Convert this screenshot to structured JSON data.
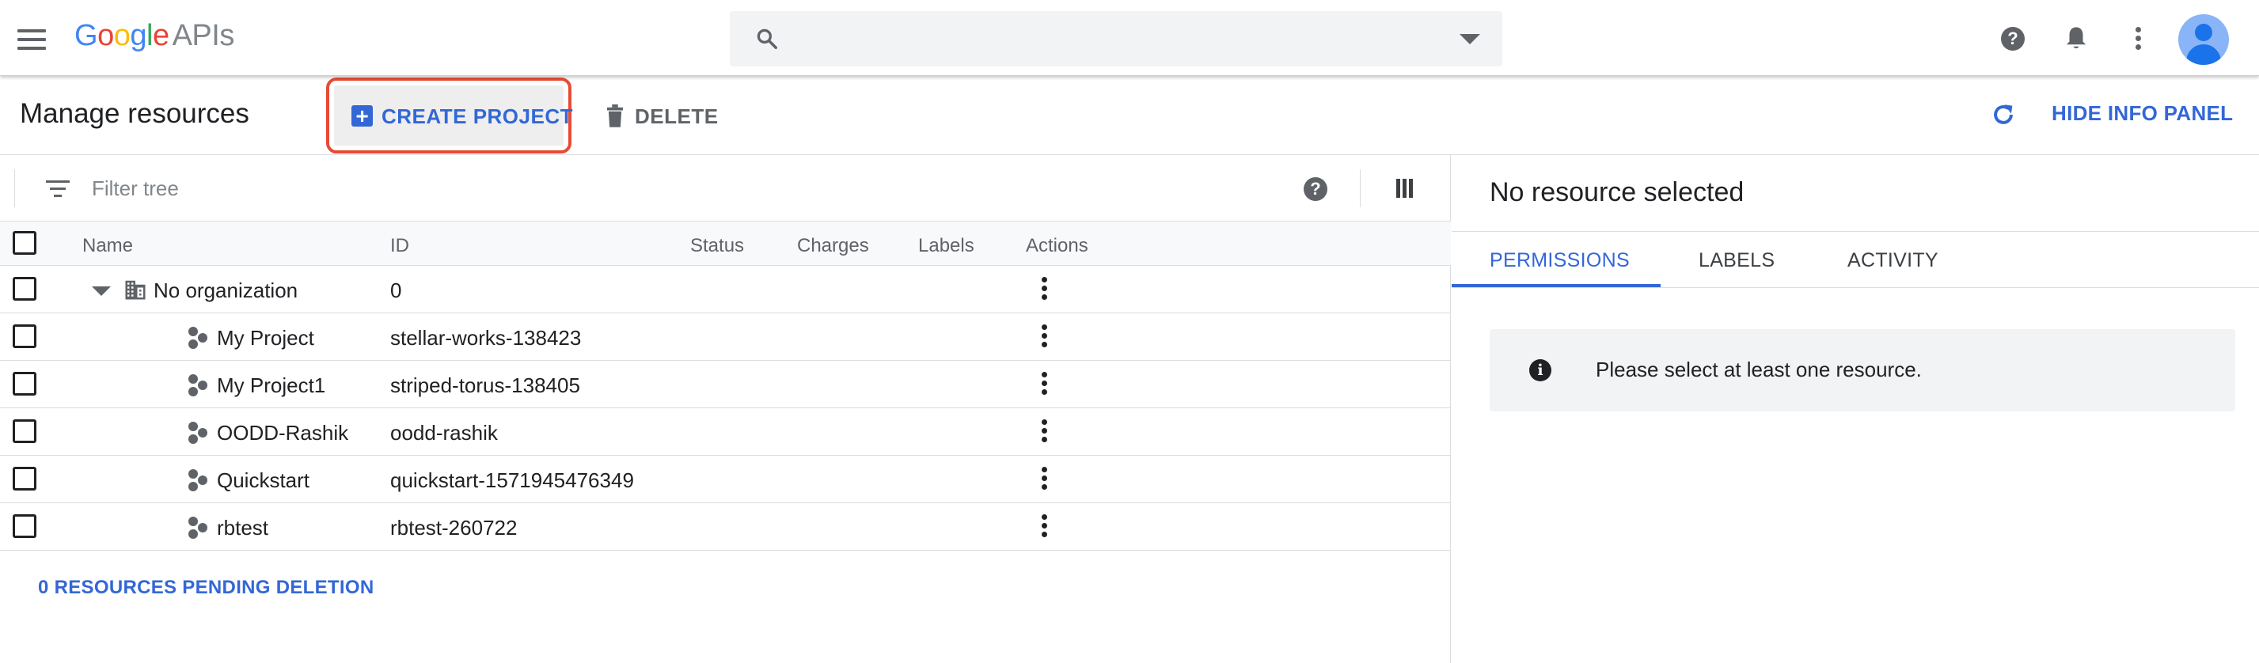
{
  "app": {
    "logo_letters": [
      {
        "char": "G",
        "color": "#4285f4"
      },
      {
        "char": "o",
        "color": "#ea4335"
      },
      {
        "char": "o",
        "color": "#fbbc05"
      },
      {
        "char": "g",
        "color": "#4285f4"
      },
      {
        "char": "l",
        "color": "#34a853"
      },
      {
        "char": "e",
        "color": "#ea4335"
      }
    ],
    "logo_suffix": "APIs"
  },
  "search": {
    "value": "",
    "icon": "search-icon",
    "dropdown_icon": "caret-down-icon"
  },
  "topbar_icons": [
    "help-icon",
    "notifications-icon",
    "more-vert-icon",
    "avatar"
  ],
  "toolbar": {
    "title": "Manage resources",
    "create_label": "CREATE PROJECT",
    "delete_label": "DELETE",
    "hide_panel_label": "HIDE INFO PANEL"
  },
  "filter": {
    "placeholder": "Filter tree"
  },
  "table": {
    "columns": {
      "name": "Name",
      "id": "ID",
      "status": "Status",
      "charges": "Charges",
      "labels": "Labels",
      "actions": "Actions"
    },
    "rows": [
      {
        "name": "No organization",
        "id": "0",
        "type": "organization"
      },
      {
        "name": "My Project",
        "id": "stellar-works-138423",
        "type": "project"
      },
      {
        "name": "My Project1",
        "id": "striped-torus-138405",
        "type": "project"
      },
      {
        "name": "OODD-Rashik",
        "id": "oodd-rashik",
        "type": "project"
      },
      {
        "name": "Quickstart",
        "id": "quickstart-1571945476349",
        "type": "project"
      },
      {
        "name": "rbtest",
        "id": "rbtest-260722",
        "type": "project"
      }
    ]
  },
  "pending_deletion_label": "0 RESOURCES PENDING DELETION",
  "info_panel": {
    "title": "No resource selected",
    "tabs": [
      "PERMISSIONS",
      "LABELS",
      "ACTIVITY"
    ],
    "active_tab": "PERMISSIONS",
    "message": "Please select at least one resource."
  },
  "colors": {
    "accent": "#3367d6",
    "highlight_box": "#e84b35",
    "icon_gray": "#5f6368"
  }
}
